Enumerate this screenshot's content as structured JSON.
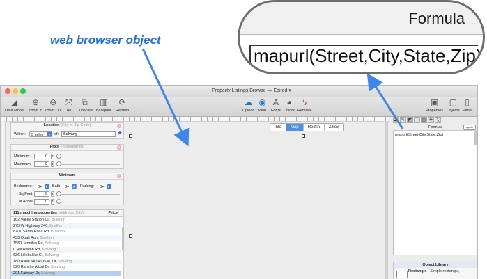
{
  "annotation": {
    "callout": "web browser object"
  },
  "magnifier": {
    "header": "Formula",
    "formula": "mapurl(Street,City,State,Zip)"
  },
  "window": {
    "title": "Property Listings:Browse — Edited ▾",
    "toolbar_left": [
      {
        "label": "Data Mode",
        "icon": "data-mode-icon",
        "glyph": "◢"
      },
      {
        "label": "Zoom In",
        "icon": "zoom-in-icon",
        "glyph": "⊕"
      },
      {
        "label": "Zoom Out",
        "icon": "zoom-out-icon",
        "glyph": "⊖"
      },
      {
        "label": "All",
        "icon": "fit-all-icon",
        "glyph": "⤧"
      },
      {
        "label": "Duplicate",
        "icon": "duplicate-icon",
        "glyph": "⧉"
      },
      {
        "label": "Blueprint",
        "icon": "blueprint-icon",
        "glyph": "▥"
      },
      {
        "label": "Refresh",
        "icon": "refresh-icon",
        "glyph": "⟳"
      }
    ],
    "toolbar_center": [
      {
        "label": "Upload",
        "icon": "upload-icon",
        "glyph": "☁"
      },
      {
        "label": "Web",
        "icon": "web-icon",
        "glyph": "◉"
      },
      {
        "label": "Fonts",
        "icon": "fonts-icon",
        "glyph": "A"
      },
      {
        "label": "Colors",
        "icon": "colors-icon",
        "glyph": "◕"
      },
      {
        "label": "Remove",
        "icon": "remove-icon",
        "glyph": "ϟ"
      }
    ],
    "toolbar_right": [
      {
        "label": "Properties",
        "icon": "properties-icon",
        "glyph": "▣"
      },
      {
        "label": "Objects",
        "icon": "objects-icon",
        "glyph": "▢"
      },
      {
        "label": "Pane",
        "icon": "pane-icon",
        "glyph": "▯"
      }
    ]
  },
  "location": {
    "title": "Location",
    "hint": "(City or Zip Code)",
    "within_label": "Within:",
    "within_value": "5 miles",
    "of_label": "of:",
    "of_value": "Solvang"
  },
  "price": {
    "title": "Price",
    "hint": "(in thousands)",
    "min_label": "Minimum:",
    "min_value": "0",
    "max_label": "Maximum:",
    "max_value": "0"
  },
  "minimum": {
    "title": "Minimum",
    "bedrooms_label": "Bedrooms:",
    "bedrooms_value": "0+",
    "bath_label": "Bath:",
    "bath_value": "0+",
    "parking_label": "Parking:",
    "parking_value": "0+",
    "sqft_label": "Sq Feet:",
    "sqft_value": "0",
    "lot_label": "Lot Acres:",
    "lot_value": "0"
  },
  "list": {
    "count_text": "111 matching properties",
    "hint": "(Address, City)",
    "price_header": "Price",
    "rows": [
      {
        "street": "162 Valley Station Cir,",
        "city": "Buellton"
      },
      {
        "street": "275 W Highway 246,",
        "city": "Buellton"
      },
      {
        "street": "8701 Santa Rosa Rd,",
        "city": "Buellton"
      },
      {
        "street": "433 Quail Run,",
        "city": "Buellton"
      },
      {
        "street": "1580 Jennilsa Rd,",
        "city": "Solvang"
      },
      {
        "street": "0 Hill Haven Rd,",
        "city": "Solvang"
      },
      {
        "street": "636 Lillebakke Ct,",
        "city": "Solvang"
      },
      {
        "street": "180 RANCHO ALISAL Dr,",
        "city": "Solvang"
      },
      {
        "street": "520 Rancho Alisal Dr,",
        "city": "Solvang"
      },
      {
        "street": "291 Fairway Dr,",
        "city": "Solvang"
      }
    ],
    "selected_index": 9
  },
  "canvas_tabs": [
    "Info",
    "Map",
    "Redfin",
    "Zillow"
  ],
  "active_tab": "Map",
  "formula_panel": {
    "title": "Formula",
    "apply_label": "Apply",
    "value": "mapurl(Street,City,State,Zip)"
  },
  "object_library": {
    "title": "Object Library",
    "item_name": "Rectangle",
    "item_desc": "- Simple rectangle,"
  },
  "colors": {
    "accent": "#1f6fe8",
    "selection": "#b6cef0",
    "active_tab": "#4f8fe0"
  }
}
